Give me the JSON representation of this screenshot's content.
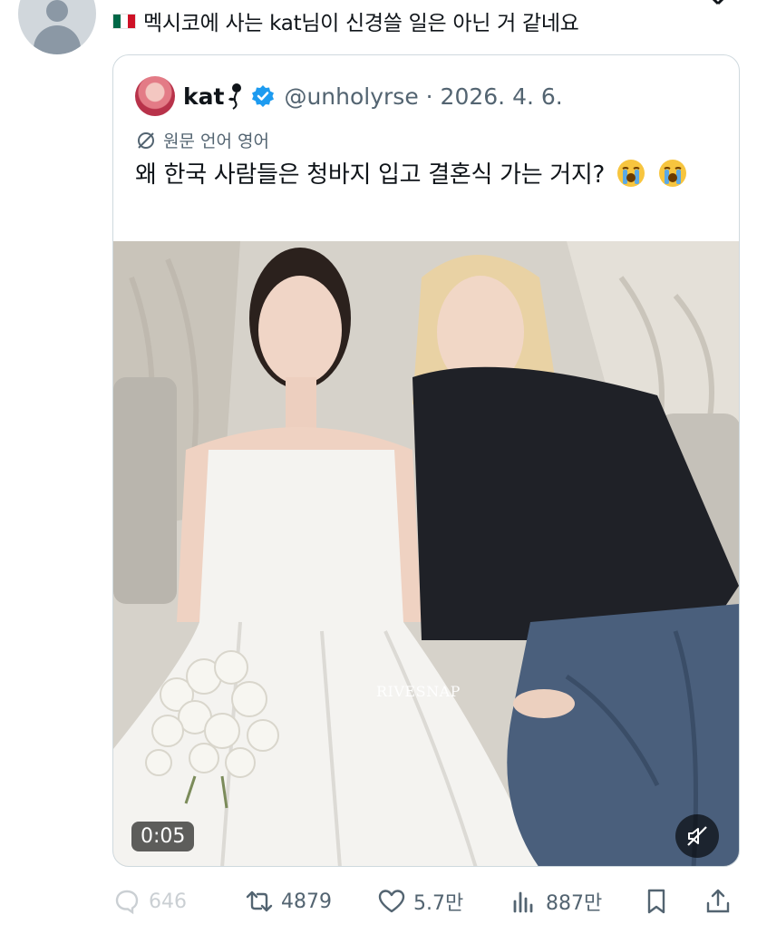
{
  "reply": {
    "text": "멕시코에 사는 kat님이 신경쓸 일은 아닌 거 같네요",
    "flag_icon": "mexico-flag-icon"
  },
  "quoted_tweet": {
    "display_name": "kat",
    "handle_and_date": "@unholyrse · 2026. 4. 6.",
    "translate_label": "원문 언어 영어",
    "text": "왜 한국 사람들은 청바지 입고 결혼식 가는 거지?",
    "emoji": "loudly-crying-face-icon",
    "media": {
      "watermark": "RIVESNAP",
      "timer": "0:05",
      "muted": true
    }
  },
  "actions": {
    "replies": "646",
    "retweets": "4879",
    "likes": "5.7만",
    "views": "887만"
  },
  "colors": {
    "text": "#0f1419",
    "secondary": "#536471",
    "verified": "#1d9bf0",
    "border": "#cfd9de"
  }
}
